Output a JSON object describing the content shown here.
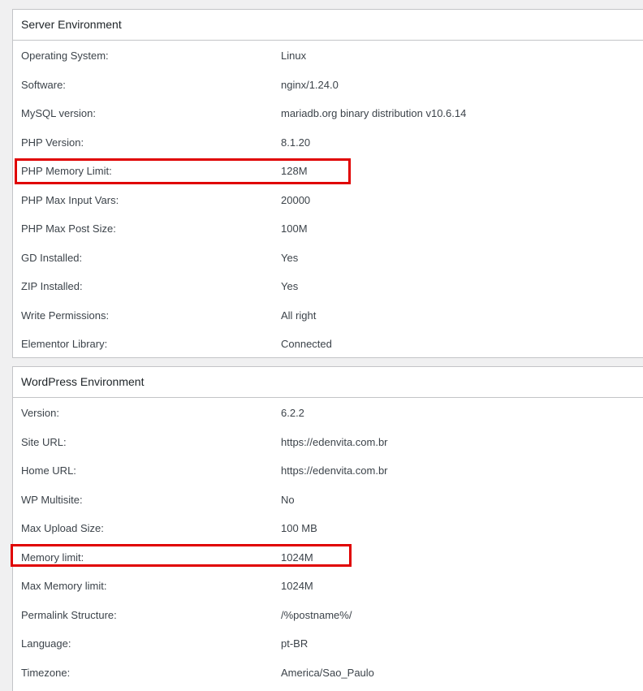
{
  "server_environment": {
    "title": "Server Environment",
    "rows": [
      {
        "label": "Operating System:",
        "value": "Linux"
      },
      {
        "label": "Software:",
        "value": "nginx/1.24.0"
      },
      {
        "label": "MySQL version:",
        "value": "mariadb.org binary distribution v10.6.14"
      },
      {
        "label": "PHP Version:",
        "value": "8.1.20"
      },
      {
        "label": "PHP Memory Limit:",
        "value": "128M"
      },
      {
        "label": "PHP Max Input Vars:",
        "value": "20000"
      },
      {
        "label": "PHP Max Post Size:",
        "value": "100M"
      },
      {
        "label": "GD Installed:",
        "value": "Yes"
      },
      {
        "label": "ZIP Installed:",
        "value": "Yes"
      },
      {
        "label": "Write Permissions:",
        "value": "All right"
      },
      {
        "label": "Elementor Library:",
        "value": "Connected"
      }
    ]
  },
  "wordpress_environment": {
    "title": "WordPress Environment",
    "rows": [
      {
        "label": "Version:",
        "value": "6.2.2"
      },
      {
        "label": "Site URL:",
        "value": "https://edenvita.com.br"
      },
      {
        "label": "Home URL:",
        "value": "https://edenvita.com.br"
      },
      {
        "label": "WP Multisite:",
        "value": "No"
      },
      {
        "label": "Max Upload Size:",
        "value": "100 MB"
      },
      {
        "label": "Memory limit:",
        "value": "1024M"
      },
      {
        "label": "Max Memory limit:",
        "value": "1024M"
      },
      {
        "label": "Permalink Structure:",
        "value": "/%postname%/"
      },
      {
        "label": "Language:",
        "value": "pt-BR"
      },
      {
        "label": "Timezone:",
        "value": "America/Sao_Paulo"
      }
    ]
  },
  "colors": {
    "highlight_border": "#e00000",
    "panel_border": "#c3c4c7",
    "background": "#f0f0f1"
  }
}
